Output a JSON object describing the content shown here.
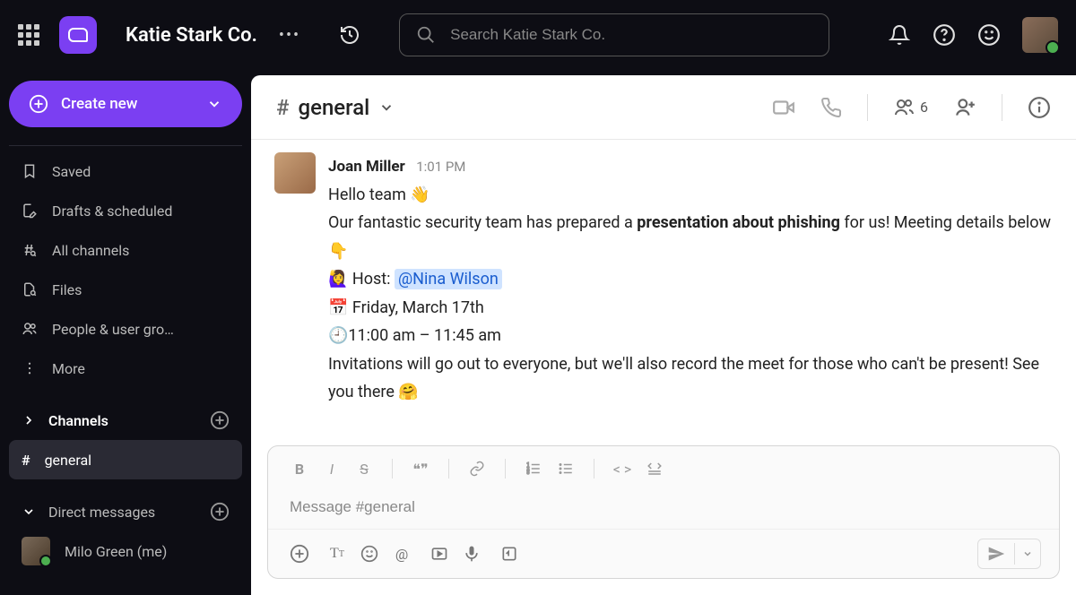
{
  "header": {
    "workspace_name": "Katie Stark Co.",
    "search_placeholder": "Search Katie Stark Co."
  },
  "sidebar": {
    "create_label": "Create new",
    "items": [
      {
        "icon": "bookmark",
        "label": "Saved"
      },
      {
        "icon": "draft",
        "label": "Drafts & scheduled"
      },
      {
        "icon": "hash",
        "label": "All channels"
      },
      {
        "icon": "file",
        "label": "Files"
      },
      {
        "icon": "people",
        "label": "People & user gro…"
      },
      {
        "icon": "more",
        "label": "More"
      }
    ],
    "channels_section": "Channels",
    "channel_active": "general",
    "dm_section": "Direct messages",
    "dm_item": "Milo Green (me)"
  },
  "chat": {
    "channel_name": "general",
    "member_count": "6"
  },
  "message": {
    "author": "Joan Miller",
    "time": "1:01 PM",
    "line1_pre": "Hello team ",
    "line1_emoji": "👋",
    "line2_pre": "Our fantastic security team has prepared a ",
    "line2_bold": "presentation about phishing",
    "line2_post": " for us! Meeting details below  ",
    "line2_emoji": "👇",
    "line3_emoji": "🙋‍♀️",
    "line3_text": " Host: ",
    "line3_mention": "@Nina Wilson",
    "line4_emoji": "📅",
    "line4_text": " Friday, March 17th",
    "line5_emoji": "🕘",
    "line5_text": "11:00 am – 11:45 am",
    "line6_pre": "Invitations will go out to everyone, but we'll also record the meet for those who can't be present! See you there ",
    "line6_emoji": "🤗"
  },
  "composer": {
    "placeholder": "Message #general"
  }
}
